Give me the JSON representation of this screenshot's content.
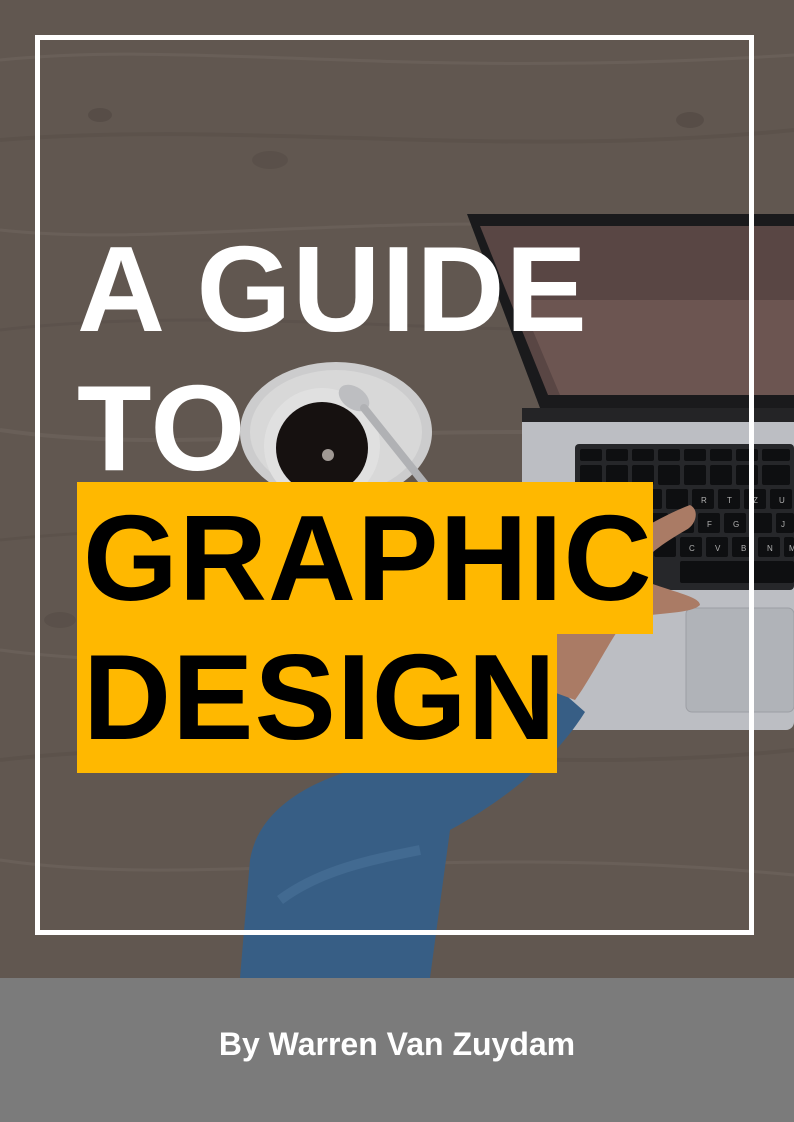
{
  "colors": {
    "highlight": "#ffb800",
    "footer": "#7b7b7b",
    "title_text": "#ffffff",
    "highlight_text": "#000000",
    "wood": "#6f645c"
  },
  "cover": {
    "title_lines": [
      "A GUIDE",
      "TO",
      "GRAPHIC",
      "DESIGN"
    ],
    "author": "By Warren Van Zuydam"
  },
  "photo": {
    "subject": "laptop-coffee-desk-photo",
    "keyboard_keys": [
      "R",
      "T",
      "Z",
      "U",
      "F",
      "G",
      "J",
      "C",
      "V",
      "B",
      "N",
      "M"
    ]
  }
}
